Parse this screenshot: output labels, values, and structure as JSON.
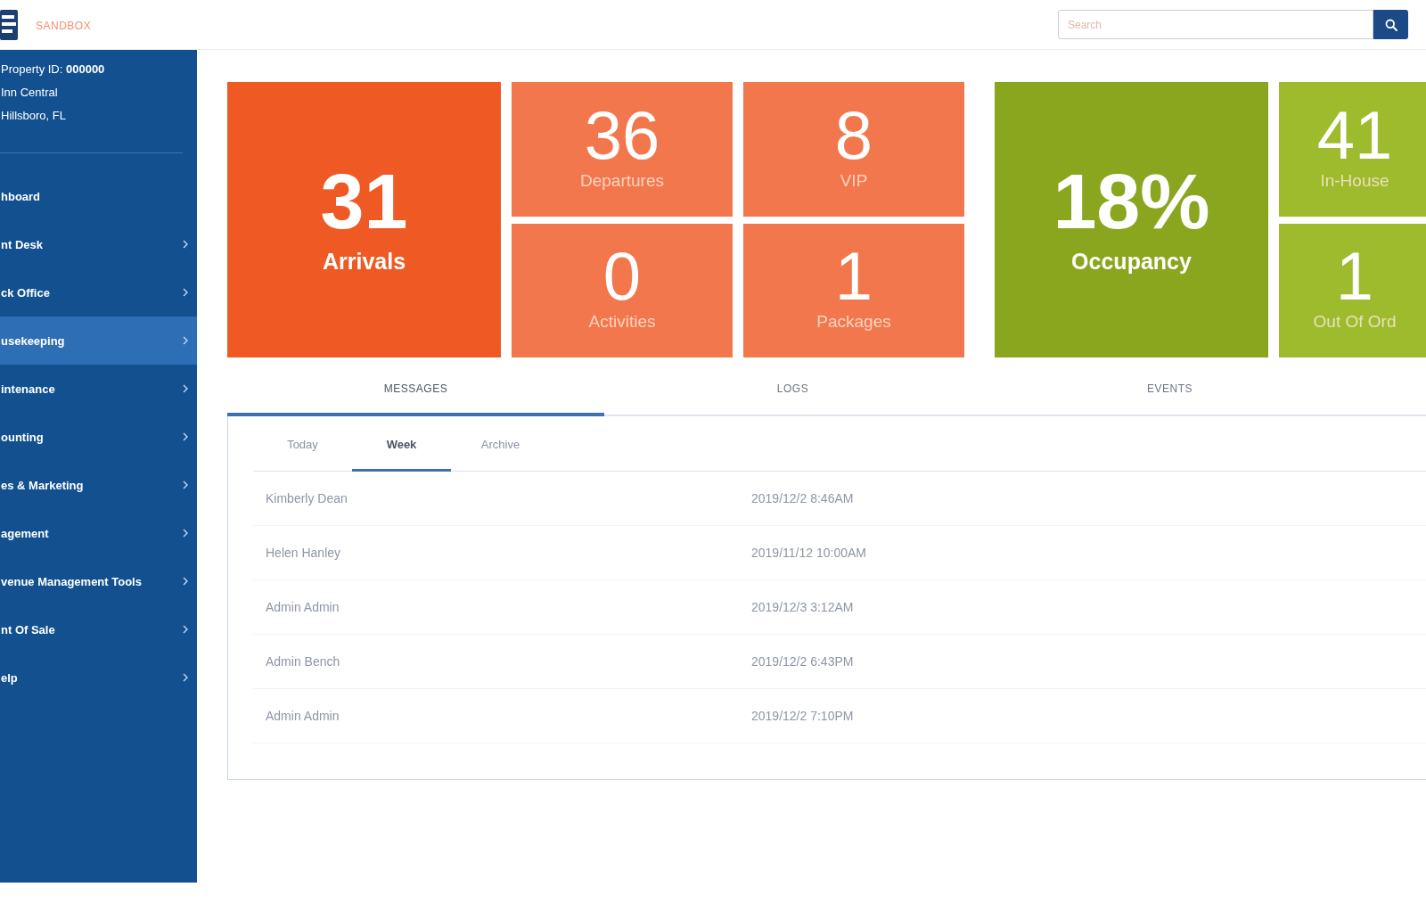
{
  "top_bar": {
    "environment_label": "SANDBOX",
    "search": {
      "placeholder": "Search"
    }
  },
  "sidebar": {
    "property": {
      "id_line": "Property ID: **000000**",
      "name": "Inn Central",
      "location": "Hillsboro, FL"
    },
    "items": [
      {
        "label": "hboard",
        "expandable": false,
        "selected": false
      },
      {
        "label": "nt Desk",
        "expandable": true,
        "selected": false
      },
      {
        "label": "ck Office",
        "expandable": true,
        "selected": false
      },
      {
        "label": "usekeeping",
        "expandable": true,
        "selected": true
      },
      {
        "label": "intenance",
        "expandable": true,
        "selected": false
      },
      {
        "label": "ounting",
        "expandable": true,
        "selected": false
      },
      {
        "label": "es & Marketing",
        "expandable": true,
        "selected": false
      },
      {
        "label": "agement",
        "expandable": true,
        "selected": false
      },
      {
        "label": "venue Management Tools",
        "expandable": true,
        "selected": false
      },
      {
        "label": "nt Of Sale",
        "expandable": true,
        "selected": false
      },
      {
        "label": "elp",
        "expandable": true,
        "selected": false
      }
    ]
  },
  "tile_groups": [
    {
      "tiles": [
        {
          "kind": "primary",
          "value": "31",
          "label": "Arrivals",
          "color": "#ef5a24"
        },
        {
          "kind": "secondary",
          "value": "36",
          "label": "Departures",
          "color": "#f2774c"
        },
        {
          "kind": "secondary",
          "value": "8",
          "label": "VIP",
          "color": "#f2774c"
        },
        {
          "kind": "secondary",
          "value": "0",
          "label": "Activities",
          "color": "#f2774c"
        },
        {
          "kind": "secondary",
          "value": "1",
          "label": "Packages",
          "color": "#f2774c"
        }
      ]
    },
    {
      "tiles": [
        {
          "kind": "primary",
          "value": "18%",
          "label": "Occupancy",
          "color": "#8aa61e"
        },
        {
          "kind": "secondary",
          "value": "41",
          "label": "In-House",
          "color": "#9dbb2d"
        },
        {
          "kind": "secondary",
          "value": "1",
          "label": "Out Of Ord",
          "color": "#9dbb2d"
        }
      ]
    }
  ],
  "section_tabs": [
    {
      "label": "MESSAGES",
      "selected": true
    },
    {
      "label": "LOGS",
      "selected": false
    },
    {
      "label": "EVENTS",
      "selected": false
    }
  ],
  "list": {
    "filter_tabs": [
      {
        "label": "Today",
        "selected": false
      },
      {
        "label": "Week",
        "selected": true
      },
      {
        "label": "Archive",
        "selected": false
      }
    ],
    "rows": [
      {
        "name": "Kimberly Dean",
        "time": "2019/12/2 8:46AM"
      },
      {
        "name": "Helen Hanley",
        "time": "2019/11/12 10:00AM"
      },
      {
        "name": "Admin Admin",
        "time": "2019/12/3 3:12AM"
      },
      {
        "name": "Admin Bench",
        "time": "2019/12/2 6:43PM"
      },
      {
        "name": "Admin Admin",
        "time": "2019/12/2 7:10PM"
      }
    ]
  }
}
